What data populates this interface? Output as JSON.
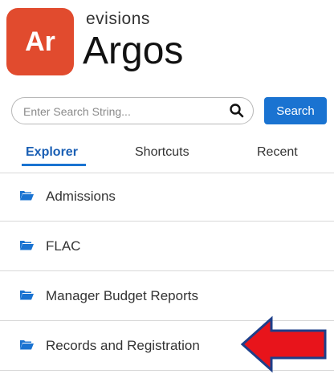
{
  "brand": {
    "badge": "Ar",
    "company": "evisions",
    "product": "Argos"
  },
  "search": {
    "placeholder": "Enter Search String...",
    "button_label": "Search"
  },
  "tabs": [
    {
      "label": "Explorer",
      "active": true
    },
    {
      "label": "Shortcuts",
      "active": false
    },
    {
      "label": "Recent",
      "active": false
    }
  ],
  "folders": [
    {
      "label": "Admissions"
    },
    {
      "label": "FLAC"
    },
    {
      "label": "Manager Budget Reports"
    },
    {
      "label": "Records and Registration"
    }
  ],
  "icons": {
    "search": "search-icon",
    "folder": "folder-open-icon",
    "pointer": "red-arrow-pointer"
  },
  "colors": {
    "brand": "#e14b2e",
    "accent": "#1a73d1",
    "arrow": "#e8141b",
    "arrow_outline": "#1e3f8a"
  }
}
